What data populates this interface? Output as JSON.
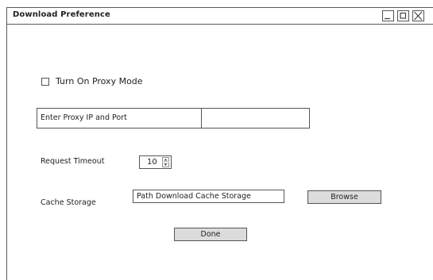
{
  "window": {
    "title": "Download Preference",
    "controls": {
      "minimize_icon": "minimize-icon",
      "maximize_icon": "maximize-icon",
      "close_icon": "close-icon"
    }
  },
  "proxy": {
    "checkbox_label": "Turn On Proxy Mode",
    "checked": false,
    "field_label": "Enter Proxy IP and Port",
    "field_value": ""
  },
  "timeout": {
    "label": "Request Timeout",
    "value": "10"
  },
  "cache": {
    "label": "Cache Storage",
    "path_value": "Path Download Cache Storage",
    "browse_label": "Browse"
  },
  "actions": {
    "done_label": "Done"
  }
}
